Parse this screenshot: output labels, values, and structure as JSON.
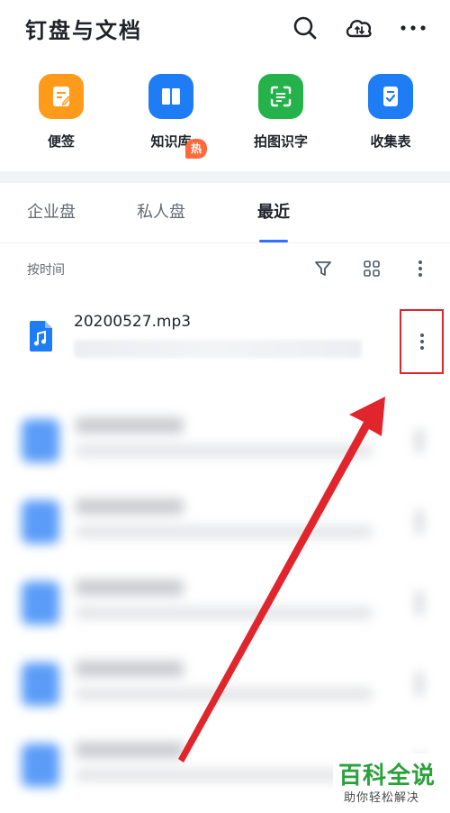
{
  "header": {
    "title": "钉盘与文档",
    "icons": [
      "search-icon",
      "cloud-sync-icon",
      "more-horizontal-icon"
    ]
  },
  "apps": [
    {
      "label": "便签",
      "icon": "note-icon",
      "color": "#ff9a1a"
    },
    {
      "label": "知识库",
      "icon": "book-icon",
      "color": "#1e7cf5",
      "badge": "热"
    },
    {
      "label": "拍图识字",
      "icon": "scan-text-icon",
      "color": "#25b24a"
    },
    {
      "label": "收集表",
      "icon": "form-icon",
      "color": "#1e7cf5"
    }
  ],
  "tabs": [
    {
      "label": "企业盘",
      "active": false
    },
    {
      "label": "私人盘",
      "active": false
    },
    {
      "label": "最近",
      "active": true
    }
  ],
  "toolbar": {
    "sort_label": "按时间",
    "icons": [
      "filter-icon",
      "grid-view-icon",
      "more-vertical-icon"
    ]
  },
  "files": [
    {
      "name": "20200527.mp3",
      "icon": "audio-file-icon"
    }
  ],
  "colors": {
    "accent": "#3370ff",
    "highlight": "#e0252c",
    "file_icon": "#1e7cf5"
  },
  "watermark": {
    "title": "百科全说",
    "subtitle": "助你轻松解决"
  }
}
